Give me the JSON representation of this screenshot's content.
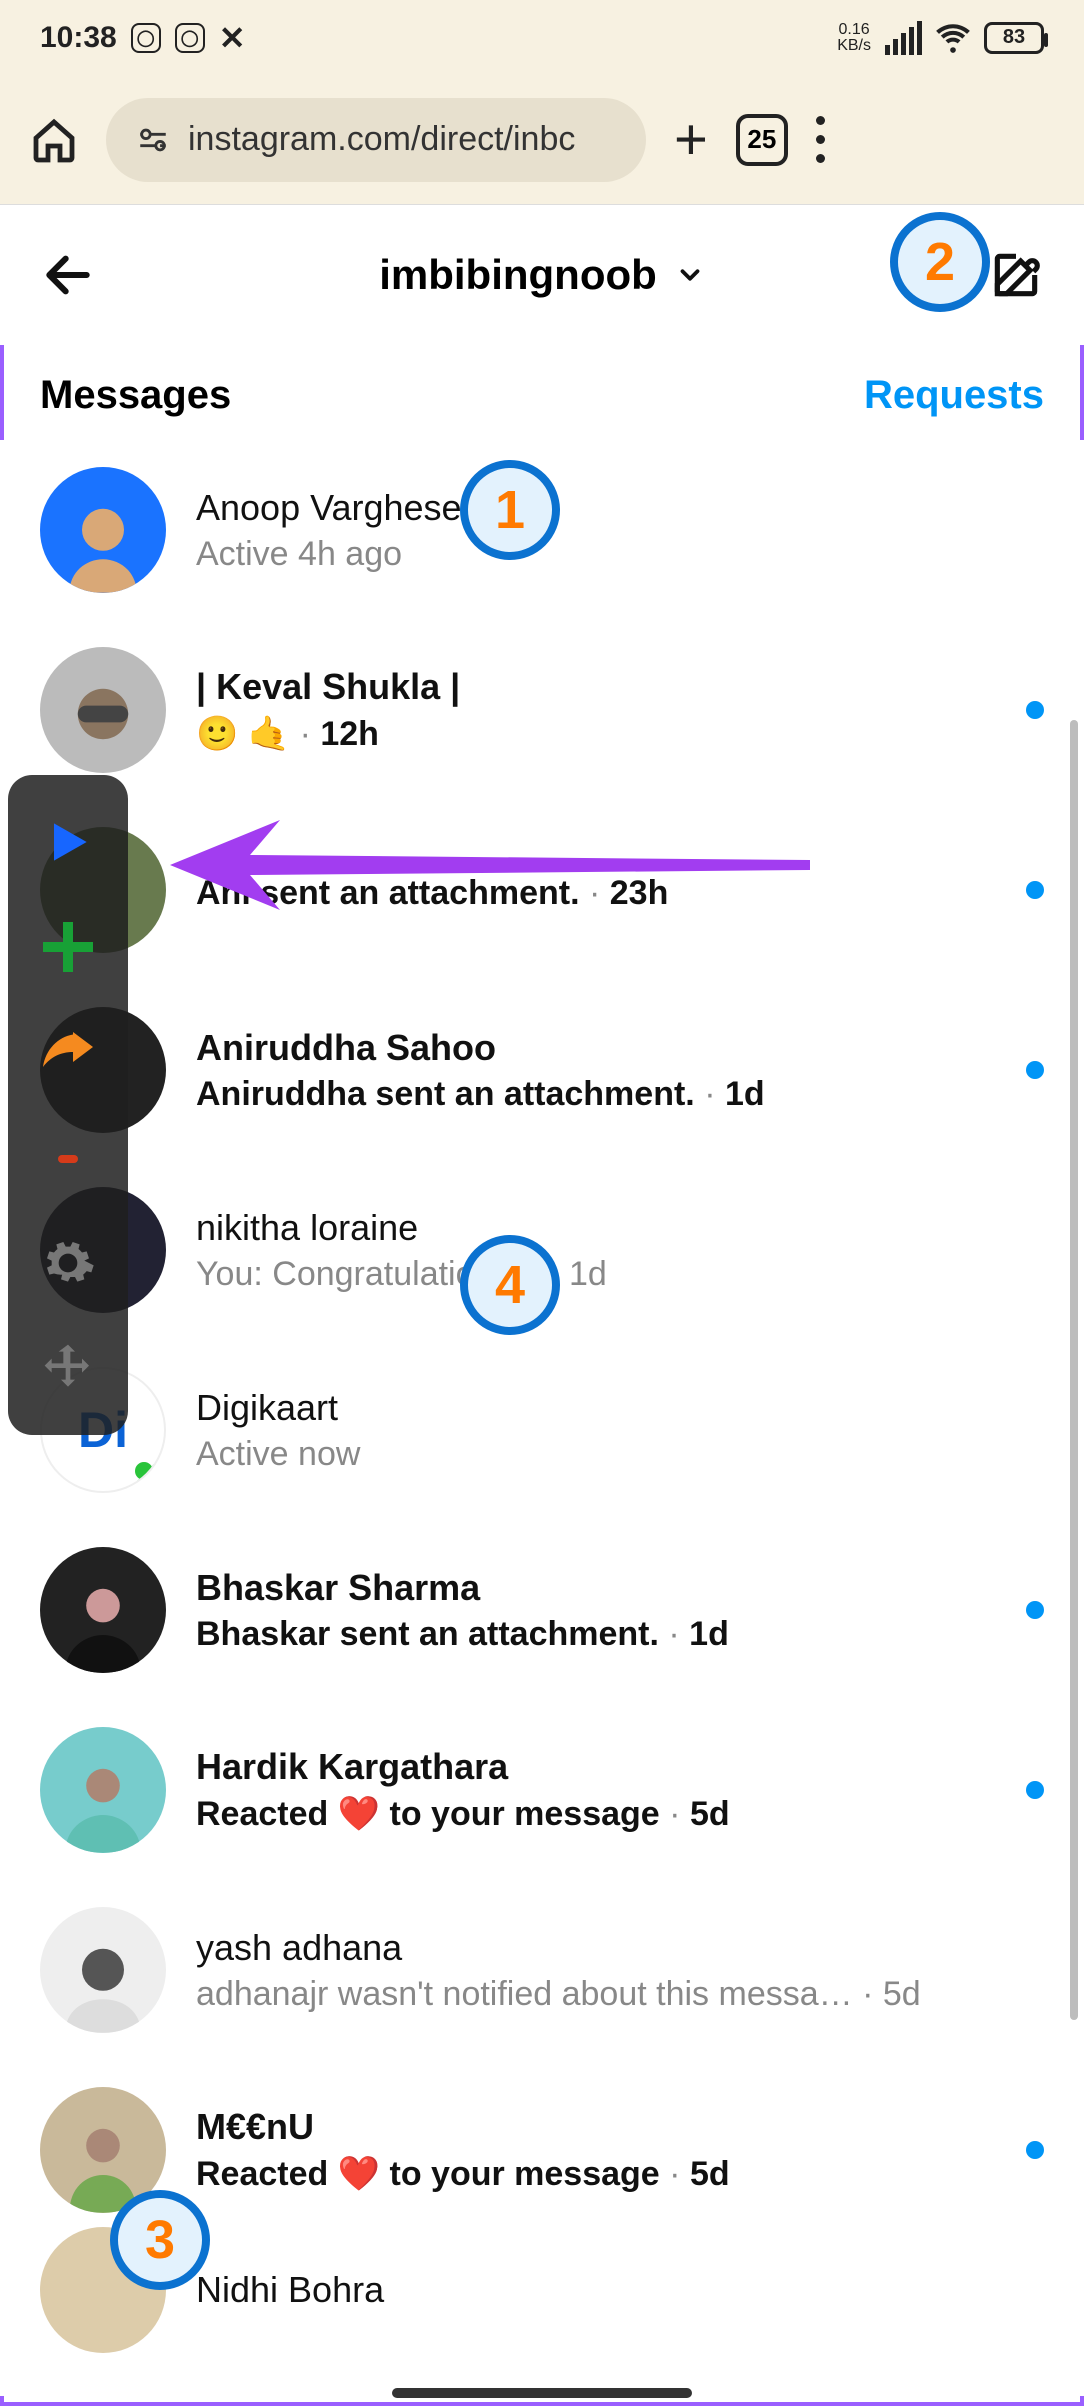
{
  "status": {
    "time": "10:38",
    "kb": "0.16\nKB/s",
    "battery": "83"
  },
  "browser": {
    "url_display": "instagram.com/direct/inbc",
    "tab_count": "25"
  },
  "header": {
    "username": "imbibingnoob"
  },
  "sections": {
    "messages_title": "Messages",
    "requests_label": "Requests"
  },
  "badges": {
    "b1": "1",
    "b2": "2",
    "b3": "3",
    "b4": "4"
  },
  "conversations": [
    {
      "name": "Anoop Varghese",
      "sub": "Active 4h ago",
      "bold": false,
      "unread": false,
      "time": ""
    },
    {
      "name": "| Keval Shukla |",
      "sub": "🙂 🤙",
      "bold": true,
      "unread": true,
      "time": "12h"
    },
    {
      "name": "",
      "sub": "Ani sent an attachment.",
      "bold": true,
      "unread": true,
      "time": "23h"
    },
    {
      "name": "Aniruddha Sahoo",
      "sub": "Aniruddha sent an attachment.",
      "bold": true,
      "unread": true,
      "time": "1d"
    },
    {
      "name": "nikitha loraine",
      "sub": "You: Congratulations!!!",
      "bold": false,
      "unread": false,
      "time": "1d"
    },
    {
      "name": "Digikaart",
      "sub": "Active now",
      "bold": false,
      "unread": false,
      "time": "",
      "online": true
    },
    {
      "name": "Bhaskar Sharma",
      "sub": "Bhaskar sent an attachment.",
      "bold": true,
      "unread": true,
      "time": "1d"
    },
    {
      "name": "Hardik Kargathara",
      "sub": "Reacted ❤️ to your message",
      "bold": true,
      "unread": true,
      "time": "5d"
    },
    {
      "name": "yash adhana",
      "sub": "adhanajr wasn't notified about this messa…",
      "bold": false,
      "unread": false,
      "time": "5d"
    },
    {
      "name": "M€€nU",
      "sub": "Reacted ❤️ to your message",
      "bold": true,
      "unread": true,
      "time": "5d"
    },
    {
      "name": "Nidhi Bohra",
      "sub": "",
      "bold": false,
      "unread": false,
      "time": ""
    }
  ]
}
